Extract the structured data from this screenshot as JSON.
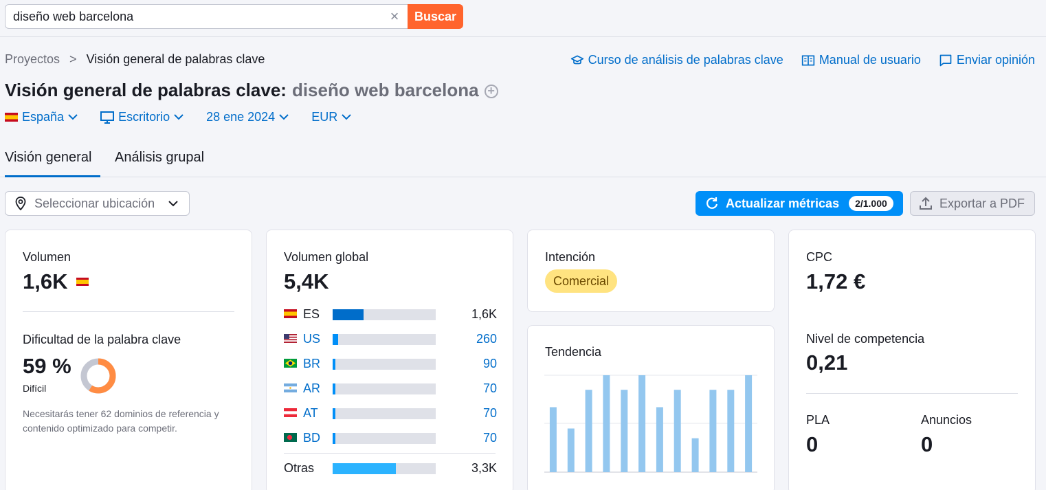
{
  "search": {
    "value": "diseño web barcelona",
    "clear_label": "×",
    "button_label": "Buscar"
  },
  "breadcrumb": {
    "root": "Proyectos",
    "separator": ">",
    "current": "Visión general de palabras clave"
  },
  "top_links": {
    "course": "Curso de análisis de palabras clave",
    "manual": "Manual de usuario",
    "feedback": "Enviar opinión"
  },
  "title": {
    "main": "Visión general de palabras clave:",
    "keyword": "diseño web barcelona",
    "add_icon": "+"
  },
  "filters": {
    "country": "España",
    "device": "Escritorio",
    "date": "28 ene 2024",
    "currency": "EUR"
  },
  "tabs": [
    {
      "label": "Visión general"
    },
    {
      "label": "Análisis grupal"
    }
  ],
  "location": {
    "placeholder": "Seleccionar ubicación"
  },
  "actions": {
    "update_label": "Actualizar métricas",
    "update_badge": "2/1.000",
    "export_label": "Exportar a PDF"
  },
  "volume": {
    "label": "Volumen",
    "value": "1,6K"
  },
  "difficulty": {
    "label": "Dificultad de la palabra clave",
    "value": "59 %",
    "percent": 59,
    "level": "Difícil",
    "note": "Necesitarás tener 62 dominios de referencia y contenido optimizado para competir.",
    "color": "#ff8c43"
  },
  "global_volume": {
    "label": "Volumen global",
    "value": "5,4K",
    "countries": [
      {
        "code": "ES",
        "value": "1,6K",
        "share": 0.3
      },
      {
        "code": "US",
        "value": "260",
        "share": 0.05
      },
      {
        "code": "BR",
        "value": "90",
        "share": 0.02
      },
      {
        "code": "AR",
        "value": "70",
        "share": 0.015
      },
      {
        "code": "AT",
        "value": "70",
        "share": 0.015
      },
      {
        "code": "BD",
        "value": "70",
        "share": 0.015
      }
    ],
    "other": {
      "label": "Otras",
      "value": "3,3K",
      "share": 0.61
    }
  },
  "intent": {
    "label": "Intención",
    "badge": "Comercial"
  },
  "trend": {
    "label": "Tendencia",
    "values": [
      0.67,
      0.45,
      0.85,
      1.0,
      0.85,
      1.0,
      0.67,
      0.85,
      0.35,
      0.85,
      0.85,
      1.0
    ],
    "color": "#93c7ef"
  },
  "cpc": {
    "label": "CPC",
    "value": "1,72 €"
  },
  "competition": {
    "label": "Nivel de competencia",
    "value": "0,21"
  },
  "pla": {
    "label": "PLA",
    "value": "0"
  },
  "ads": {
    "label": "Anuncios",
    "value": "0"
  }
}
